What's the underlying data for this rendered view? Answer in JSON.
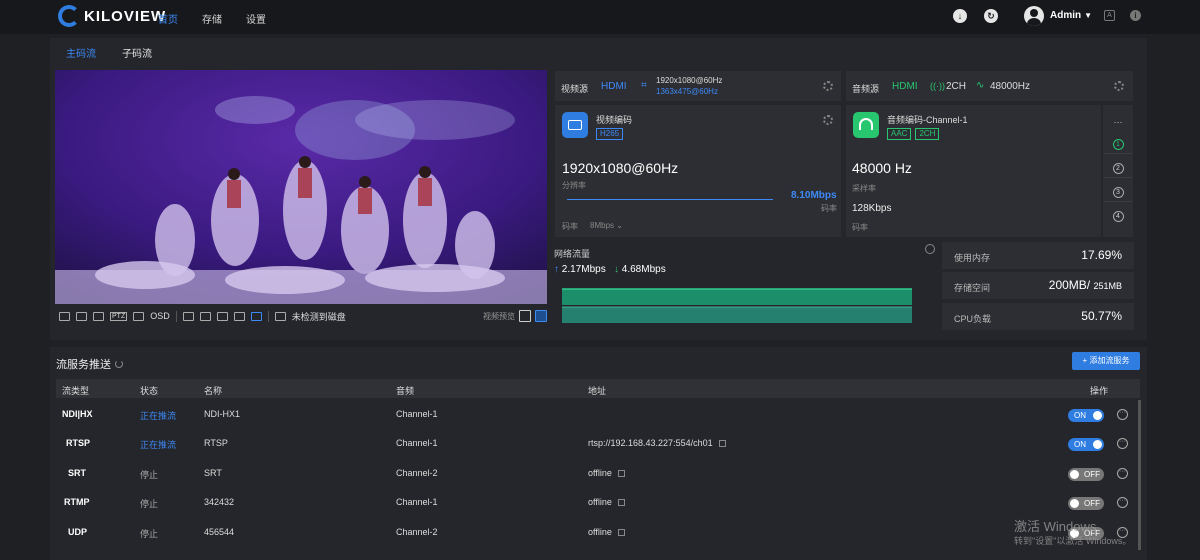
{
  "brand": {
    "logo_text": "KILOVIEW"
  },
  "nav": [
    {
      "label": "首页",
      "active": true
    },
    {
      "label": "存储",
      "active": false
    },
    {
      "label": "设置",
      "active": false
    }
  ],
  "user": {
    "name": "Admin"
  },
  "stream_tabs": [
    {
      "label": "主码流",
      "active": true
    },
    {
      "label": "子码流",
      "active": false
    }
  ],
  "video_toolbar": {
    "osd_label": "OSD",
    "disk_status": "未检测到磁盘",
    "preview_label": "视频预览",
    "ptz_label": "PTZ"
  },
  "video_source": {
    "label": "视频源",
    "type": "HDMI",
    "resolution": "1920x1080@60Hz",
    "sub_resolution": "1363x475@60Hz"
  },
  "audio_source": {
    "label": "音频源",
    "type": "HDMI",
    "channels": "2CH",
    "sample_rate": "48000Hz"
  },
  "video_encode": {
    "title": "视频编码",
    "codec": "H265",
    "resolution": "1920x1080@60Hz",
    "resolution_label": "分辨率",
    "bitrate": "8.10Mbps",
    "bitrate_label": "码率",
    "bitrate_setting_label": "码率",
    "bitrate_setting": "8Mbps"
  },
  "audio_encode": {
    "title": "音频编码-Channel-1",
    "codec": "AAC",
    "channels": "2CH",
    "sample_rate": "48000 Hz",
    "sample_rate_label": "采样率",
    "bitrate": "128Kbps",
    "bitrate_label": "码率"
  },
  "channels": [
    "1",
    "2",
    "3",
    "4"
  ],
  "network": {
    "label": "网络流量",
    "up": "2.17Mbps",
    "down": "4.68Mbps"
  },
  "stats": [
    {
      "label": "使用内存",
      "value": "17.69%",
      "suffix": ""
    },
    {
      "label": "存储空间",
      "value": "200MB/",
      "suffix": "251MB"
    },
    {
      "label": "CPU负载",
      "value": "50.77%",
      "suffix": ""
    }
  ],
  "services": {
    "title": "流服务推送",
    "add_label": "+ 添加流服务",
    "columns": [
      "流类型",
      "状态",
      "名称",
      "音频",
      "地址",
      "操作"
    ],
    "rows": [
      {
        "type": "NDI|HX",
        "state": "正在推流",
        "name": "NDI-HX1",
        "audio": "Channel-1",
        "address": "",
        "toggle": "ON"
      },
      {
        "type": "RTSP",
        "state": "正在推流",
        "name": "RTSP",
        "audio": "Channel-1",
        "address": "rtsp://192.168.43.227:554/ch01",
        "toggle": "ON"
      },
      {
        "type": "SRT",
        "state": "停止",
        "name": "SRT",
        "audio": "Channel-2",
        "address": "offline",
        "toggle": "OFF"
      },
      {
        "type": "RTMP",
        "state": "停止",
        "name": "342432",
        "audio": "Channel-1",
        "address": "offline",
        "toggle": "OFF"
      },
      {
        "type": "UDP",
        "state": "停止",
        "name": "456544",
        "audio": "Channel-2",
        "address": "offline",
        "toggle": "OFF"
      }
    ]
  },
  "watermark": {
    "line1": "激活 Windows",
    "line2": "转到\"设置\"以激活 Windows。"
  }
}
